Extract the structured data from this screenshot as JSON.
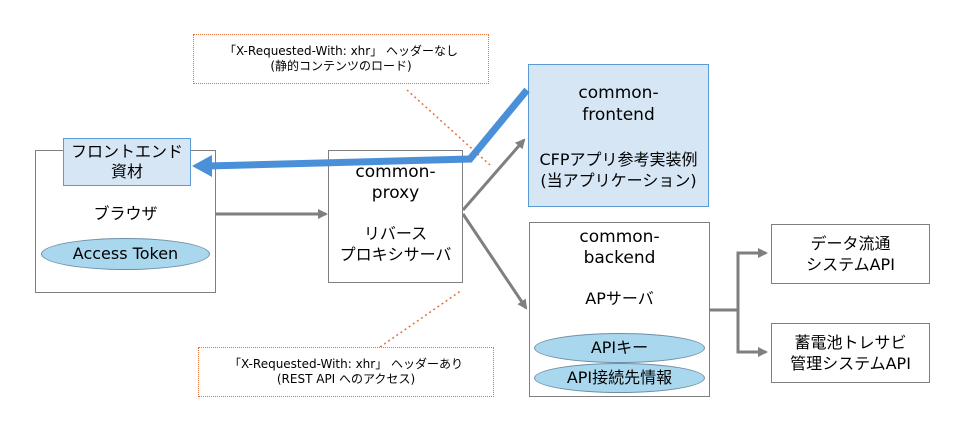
{
  "callouts": {
    "top": {
      "line1": "「X-Requested-With: xhr」 ヘッダーなし",
      "line2": "(静的コンテンツのロード)"
    },
    "bottom": {
      "line1": "「X-Requested-With: xhr」 ヘッダーあり",
      "line2": "(REST API へのアクセス)"
    }
  },
  "browser": {
    "label": "ブラウザ",
    "assets_line1": "フロントエンド",
    "assets_line2": "資材",
    "token": "Access Token"
  },
  "proxy": {
    "name_line1": "common-",
    "name_line2": "proxy",
    "role_line1": "リバース",
    "role_line2": "プロキシサーバ"
  },
  "frontend": {
    "name_line1": "common-",
    "name_line2": "frontend",
    "desc_line1": "CFPアプリ参考実装例",
    "desc_line2": "(当アプリケーション)"
  },
  "backend": {
    "name_line1": "common-",
    "name_line2": "backend",
    "role": "APサーバ",
    "api_key": "APIキー",
    "api_info": "API接続先情報"
  },
  "external": {
    "data_line1": "データ流通",
    "data_line2": "システムAPI",
    "battery_line1": "蓄電池トレサビ",
    "battery_line2": "管理システムAPI"
  },
  "colors": {
    "highlight_fill": "#d6e6f5",
    "highlight_border": "#5b9bd5",
    "flow_arrow": "#4a90d9",
    "callout_border": "#e0743a",
    "pill_fill": "#a9d7ee"
  }
}
